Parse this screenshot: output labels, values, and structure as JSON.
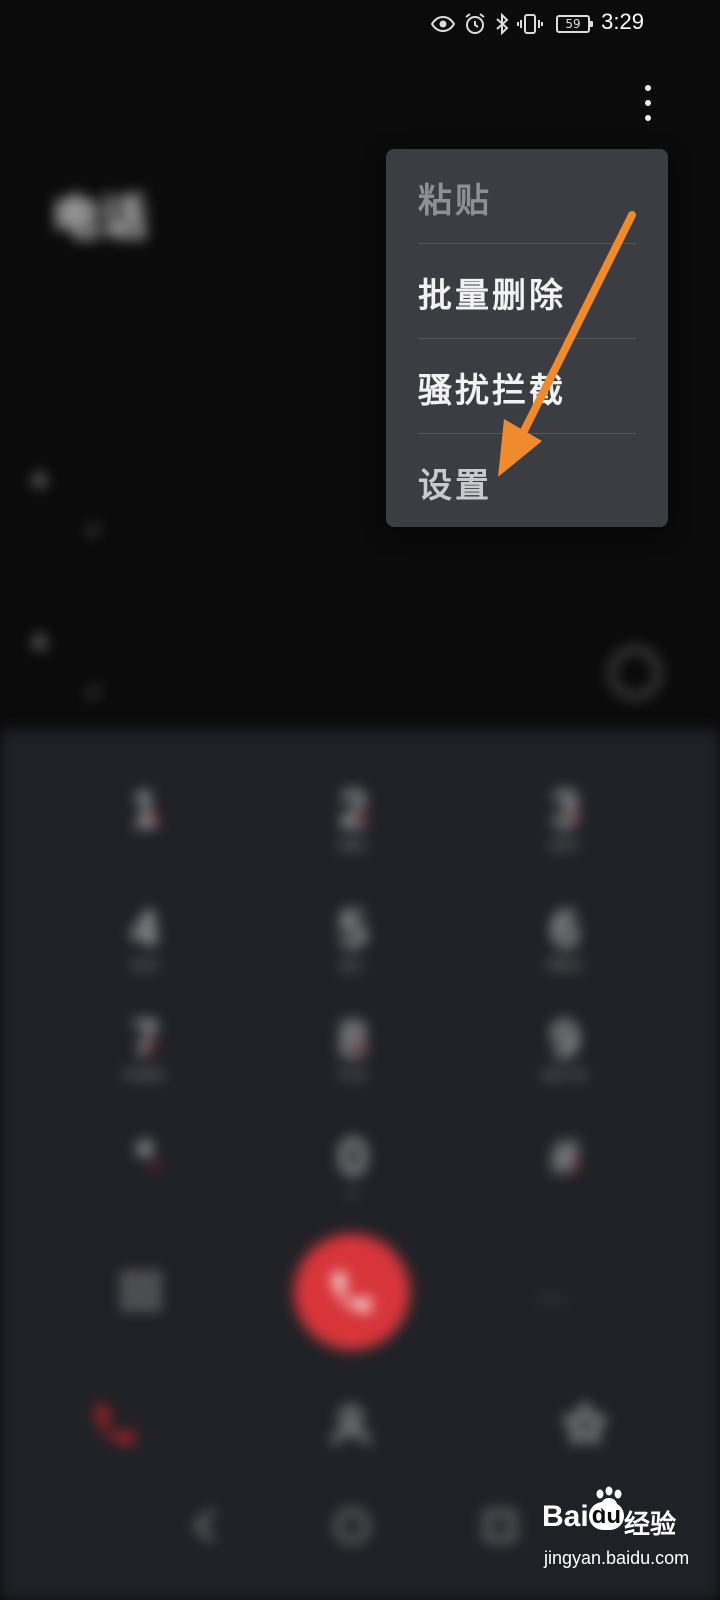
{
  "status_bar": {
    "carrier": "",
    "battery_level": "59",
    "time": "3:29",
    "icons": [
      "eye-comfort-icon",
      "alarm-icon",
      "bluetooth-icon",
      "vibrate-icon",
      "battery-icon"
    ]
  },
  "app": {
    "title": "电话",
    "contact": {
      "name": "",
      "detail": ""
    },
    "calls": [
      {
        "number": "",
        "meta": ""
      },
      {
        "number": "",
        "meta": ""
      }
    ],
    "dialpad": {
      "keys": [
        {
          "digit": "1",
          "letters": ""
        },
        {
          "digit": "2",
          "letters": "ABC"
        },
        {
          "digit": "3",
          "letters": "DEF"
        },
        {
          "digit": "4",
          "letters": "GHI"
        },
        {
          "digit": "5",
          "letters": "JKL"
        },
        {
          "digit": "6",
          "letters": "MNO"
        },
        {
          "digit": "7",
          "letters": "PQRS"
        },
        {
          "digit": "8",
          "letters": "TUV"
        },
        {
          "digit": "9",
          "letters": "WXYZ"
        },
        {
          "digit": "*",
          "letters": ""
        },
        {
          "digit": "0",
          "letters": "+"
        },
        {
          "digit": "#",
          "letters": ""
        }
      ]
    },
    "tabs": [
      {
        "icon": "phone-icon",
        "label": ""
      },
      {
        "icon": "contacts-icon",
        "label": ""
      },
      {
        "icon": "favorites-icon",
        "label": ""
      }
    ],
    "colors": {
      "accent_red": "#d7353a",
      "menu_bg": "#3b3d42",
      "dialpad_bg": "#202126"
    }
  },
  "menu": {
    "items": [
      {
        "label": "粘贴",
        "enabled": false
      },
      {
        "label": "批量删除",
        "enabled": true
      },
      {
        "label": "骚扰拦截",
        "enabled": true
      },
      {
        "label": "设置",
        "enabled": true
      }
    ]
  },
  "annotation": {
    "arrow_color": "#f08a2e"
  },
  "watermark": {
    "brand": "Bai",
    "brand_du": "du",
    "subtitle": "经验",
    "url": "jingyan.baidu.com"
  }
}
